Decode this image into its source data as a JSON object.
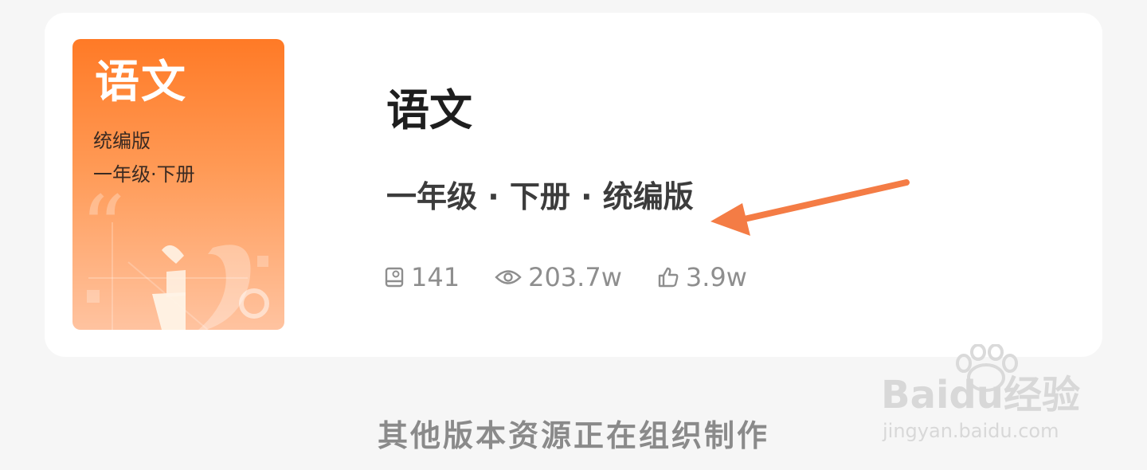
{
  "book": {
    "cover": {
      "title": "语文",
      "edition": "统编版",
      "grade": "一年级·下册"
    },
    "title": "语文",
    "meta": "一年级 · 下册 · 统编版",
    "stats": {
      "lessons": "141",
      "views": "203.7w",
      "likes": "3.9w"
    }
  },
  "footer": {
    "note": "其他版本资源正在组织制作"
  },
  "watermark": {
    "logo": "Baidu经验",
    "url": "jingyan.baidu.com"
  },
  "colors": {
    "accent": "#ff7a26",
    "arrow": "#f47c45",
    "stat_text": "#8e8e8e"
  },
  "icons": [
    "lessons-icon",
    "eye-icon",
    "thumbs-up-icon",
    "annotation-arrow-icon",
    "paw-icon"
  ]
}
